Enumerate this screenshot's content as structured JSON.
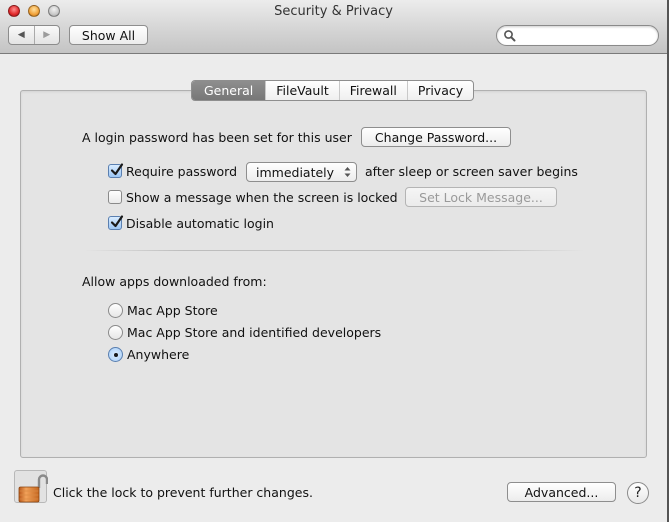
{
  "window": {
    "title": "Security & Privacy",
    "traffic_lights": [
      "close",
      "minimize",
      "zoom"
    ]
  },
  "toolbar": {
    "back_icon": "back-arrow-icon",
    "forward_icon": "forward-arrow-icon",
    "back_glyph": "◀",
    "forward_glyph": "▶",
    "show_all_label": "Show All",
    "search": {
      "value": "",
      "placeholder": "",
      "icon": "search-icon"
    }
  },
  "tabs": [
    {
      "label": "General",
      "active": true
    },
    {
      "label": "FileVault",
      "active": false
    },
    {
      "label": "Firewall",
      "active": false
    },
    {
      "label": "Privacy",
      "active": false
    }
  ],
  "general": {
    "login_password_text": "A login password has been set for this user",
    "change_password_label": "Change Password...",
    "require_password": {
      "checked": true,
      "label": "Require password",
      "select_value": "immediately",
      "suffix": "after sleep or screen saver begins"
    },
    "show_message": {
      "checked": false,
      "label": "Show a message when the screen is locked",
      "button_label": "Set Lock Message...",
      "button_enabled": false
    },
    "disable_auto_login": {
      "checked": true,
      "label": "Disable automatic login"
    },
    "allow_apps_label": "Allow apps downloaded from:",
    "allow_apps_options": [
      {
        "label": "Mac App Store",
        "selected": false
      },
      {
        "label": "Mac App Store and identified developers",
        "selected": false
      },
      {
        "label": "Anywhere",
        "selected": true
      }
    ]
  },
  "footer": {
    "lock_icon": "unlocked-padlock-icon",
    "lock_text": "Click the lock to prevent further changes.",
    "advanced_label": "Advanced...",
    "help_label": "?"
  },
  "colors": {
    "window_bg": "#ececec",
    "group_bg": "#e4e4e4",
    "active_tab": "#808080",
    "checkbox_accent": "#9cc6f5",
    "lock_orange": "#e07a2a"
  }
}
